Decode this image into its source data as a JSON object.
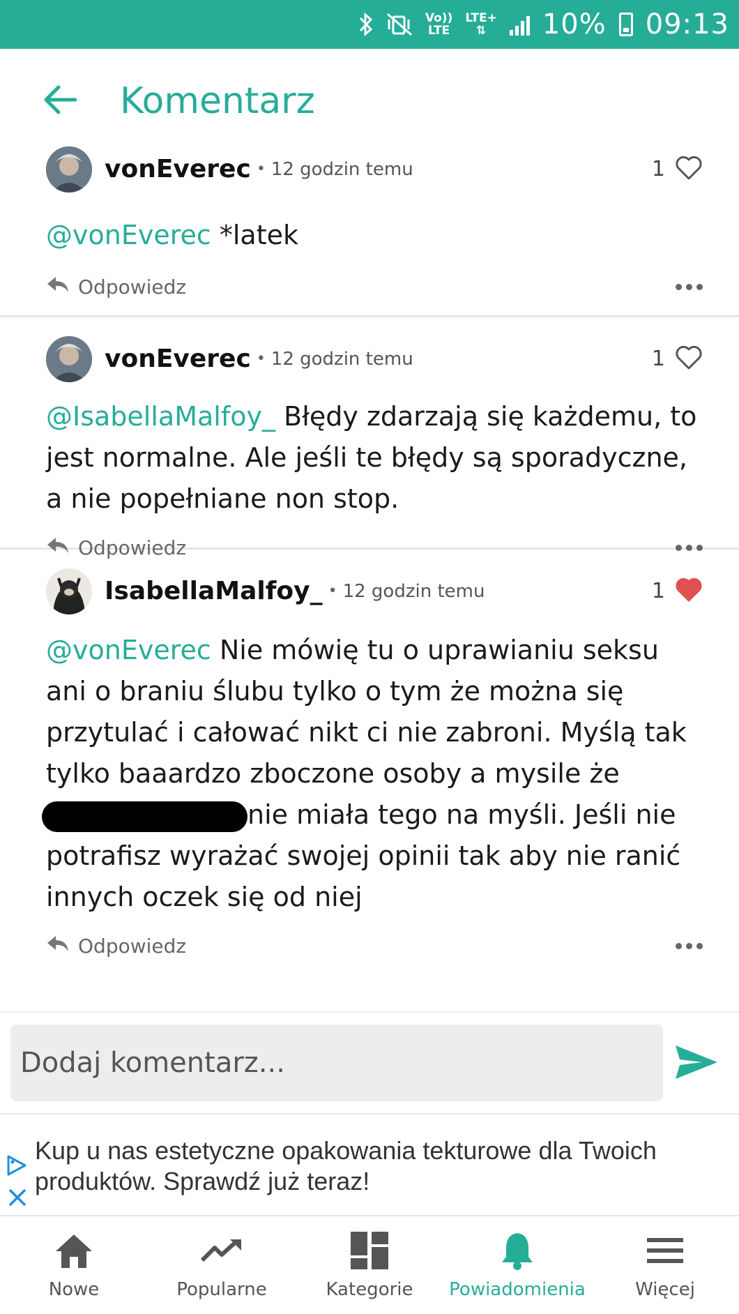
{
  "status_bar": {
    "network_top": "Vo))",
    "network_bottom": "LTE",
    "lte_plus": "LTE+",
    "battery": "10%",
    "time": "09:13"
  },
  "header": {
    "title": "Komentarz",
    "back_icon": "arrow-left-icon"
  },
  "comments": [
    {
      "username": "vonEverec",
      "time": "12 godzin temu",
      "likes": "1",
      "liked": false,
      "mention": "@vonEverec",
      "text": " *latek",
      "reply_label": "Odpowiedz"
    },
    {
      "username": "vonEverec",
      "time": "12 godzin temu",
      "likes": "1",
      "liked": false,
      "mention": "@IsabellaMalfoy_",
      "text": " Błędy zdarzają się każdemu, to jest normalne. Ale jeśli te błędy są sporadyczne, a nie popełniane non stop.",
      "reply_label": "Odpowiedz"
    },
    {
      "username": "IsabellaMalfoy_",
      "time": "12 godzin temu",
      "likes": "1",
      "liked": true,
      "mention": "@vonEverec",
      "text_before": " Nie mówię tu o uprawianiu seksu ani o braniu ślubu tylko o tym że można się przytulać i całować nikt ci nie zabroni. Myślą tak tylko baaardzo zboczone osoby a mysile że ",
      "text_after": "nie miała tego na myśli. Jeśli nie potrafisz wyrażać swojej opinii tak aby nie ranić innych oczek się od niej",
      "reply_label": "Odpowiedz"
    }
  ],
  "add_comment": {
    "placeholder": "Dodaj komentarz..."
  },
  "ad": {
    "text": "Kup u nas estetyczne opakowania tekturowe dla Twoich produktów. Sprawdź już teraz!"
  },
  "nav": {
    "items": [
      {
        "label": "Nowe",
        "icon": "home-icon"
      },
      {
        "label": "Popularne",
        "icon": "trending-icon"
      },
      {
        "label": "Kategorie",
        "icon": "categories-icon"
      },
      {
        "label": "Powiadomienia",
        "icon": "bell-icon"
      },
      {
        "label": "Więcej",
        "icon": "menu-icon"
      }
    ],
    "active": "Powiadomienia"
  },
  "colors": {
    "accent": "#26ad98",
    "heart_liked": "#e0504f"
  }
}
